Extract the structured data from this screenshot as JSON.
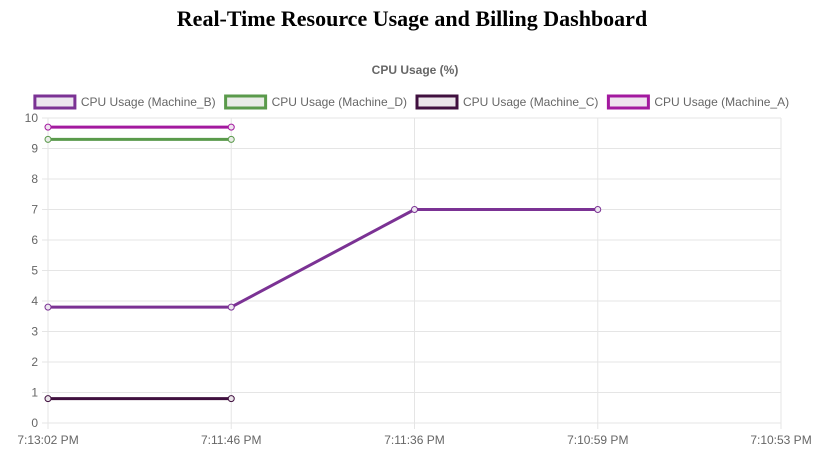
{
  "page": {
    "title": "Real-Time Resource Usage and Billing Dashboard"
  },
  "chart_data": {
    "type": "line",
    "title": "CPU Usage (%)",
    "xlabel": "",
    "ylabel": "",
    "categories": [
      "7:13:02 PM",
      "7:11:46 PM",
      "7:11:36 PM",
      "7:10:59 PM",
      "7:10:53 PM"
    ],
    "ylim": [
      0,
      10
    ],
    "yticks": [
      0,
      1,
      2,
      3,
      4,
      5,
      6,
      7,
      8,
      9,
      10
    ],
    "grid": true,
    "legend_position": "top",
    "series": [
      {
        "name": "CPU Usage (Machine_B)",
        "color": "#7b3294",
        "fill": "#ece6ef",
        "values": [
          3.8,
          3.8,
          7.0,
          7.0,
          null
        ]
      },
      {
        "name": "CPU Usage (Machine_D)",
        "color": "#5a9a4b",
        "fill": "#e9ece7",
        "values": [
          9.3,
          9.3,
          null,
          null,
          null
        ]
      },
      {
        "name": "CPU Usage (Machine_C)",
        "color": "#40103f",
        "fill": "#ebe5ea",
        "values": [
          0.8,
          0.8,
          null,
          null,
          null
        ]
      },
      {
        "name": "CPU Usage (Machine_A)",
        "color": "#a3199f",
        "fill": "#efe3ef",
        "values": [
          9.7,
          9.7,
          null,
          null,
          null
        ]
      }
    ]
  }
}
